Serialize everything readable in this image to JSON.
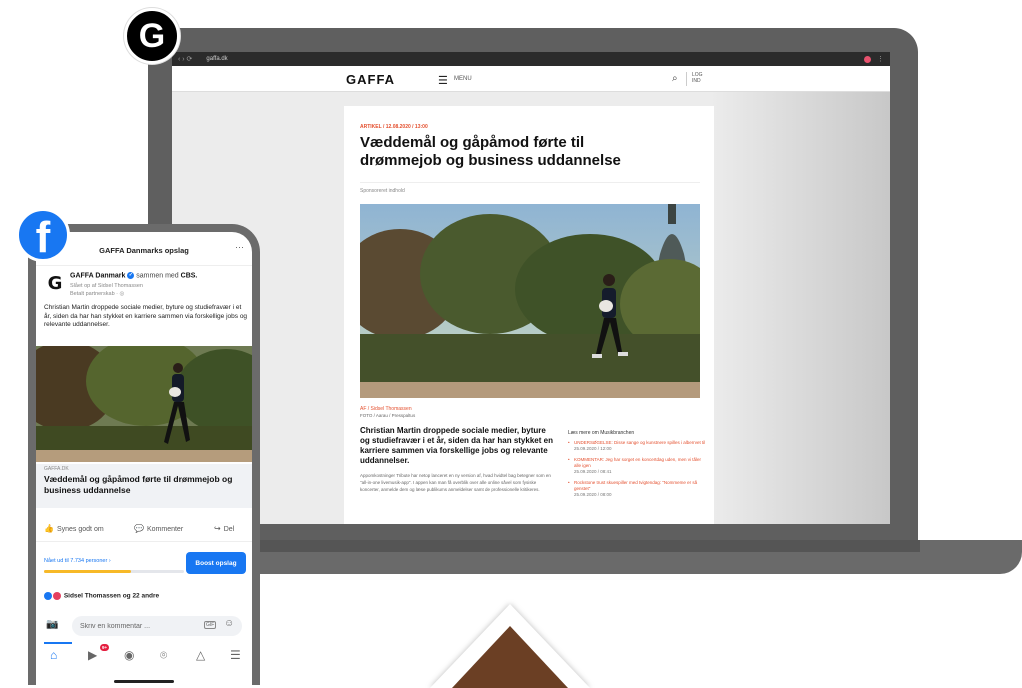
{
  "browser": {
    "nav": "‹ › ⟳",
    "url": "gaffa.dk"
  },
  "site": {
    "logo": "GAFFA",
    "menu_label": "MENU",
    "login": "LOG IND"
  },
  "article": {
    "kicker": "ARTIKEL / 12.08.2020 / 13:00",
    "title": "Væddemål og gåpåmod førte til drømmejob og business uddannelse",
    "sponsor": "Sponsoreret indhold",
    "caption_author": "AF / Sidsel Thomassen",
    "caption_photo": "FOTO / Aarau / Presspaltus",
    "lead": "Christian Martin droppede sociale medier, byture og studiefravær i et år, siden da har han stykket en karriere sammen via forskellige jobs og relevante uddannelser.",
    "body": "Appomkostninger Tribute har netop lanceret en ny version af, hvad hvidtel bag betegner som en \"all-in-one livemusik-app\". I appen kan man få overblik over alle online såvel som fysiske koncerter, anmelde dem og læse publikums anmeldelser samt de professionelle kritikeres."
  },
  "sidebar": {
    "title": "Læs mere om Musikbranchen",
    "items": [
      {
        "title": "UNDERSØGELSE: Disse sange og kunstnere spilles i alberrvet til",
        "date": "25.09.2020 / 12:00"
      },
      {
        "title": "KOMMENTAR: Jeg har sorget en koncertdag uden, men vi tåler alle igen",
        "date": "25.09.2020 / 08:41"
      },
      {
        "title": "Rockstone trust skuespiller med tvigtendag: \"Nommeme er så genstet\"",
        "date": "25.09.2020 / 08:00"
      }
    ]
  },
  "phone": {
    "header_title": "GAFFA Danmarks opslag",
    "page_name": "GAFFA Danmark",
    "with_text": "sammen med",
    "partner": "CBS.",
    "meta1": "Slået op af Sidsel Thomassen",
    "meta2": "Betalt partnerskab · ◎",
    "post_text": "Christian Martin droppede sociale medier, byture og studiefravær i et år, siden da har han stykket en karriere sammen via forskellige jobs og relevante uddannelser.",
    "link_domain": "GAFFA.DK",
    "link_headline": "Væddemål og gåpåmod førte til drømmejob og business uddannelse",
    "like_label": "Synes godt om",
    "comment_label": "Kommenter",
    "share_label": "Del",
    "reach_text": "Nået ud til 7.734 personer",
    "reach_fraction": 0.62,
    "boost_label": "Boost opslag",
    "reactions_text": "Sidsel Thomassen og 22 andre",
    "comment_placeholder": "Skriv en kommentar ...",
    "gif_label": "GIF",
    "notif_badge": "9+"
  },
  "badges": {
    "gaffa_letter": "G",
    "facebook_letter": "f"
  },
  "colors": {
    "gaffa_accent": "#e4502f",
    "facebook_blue": "#1877f2",
    "progress": "#f7b928"
  }
}
